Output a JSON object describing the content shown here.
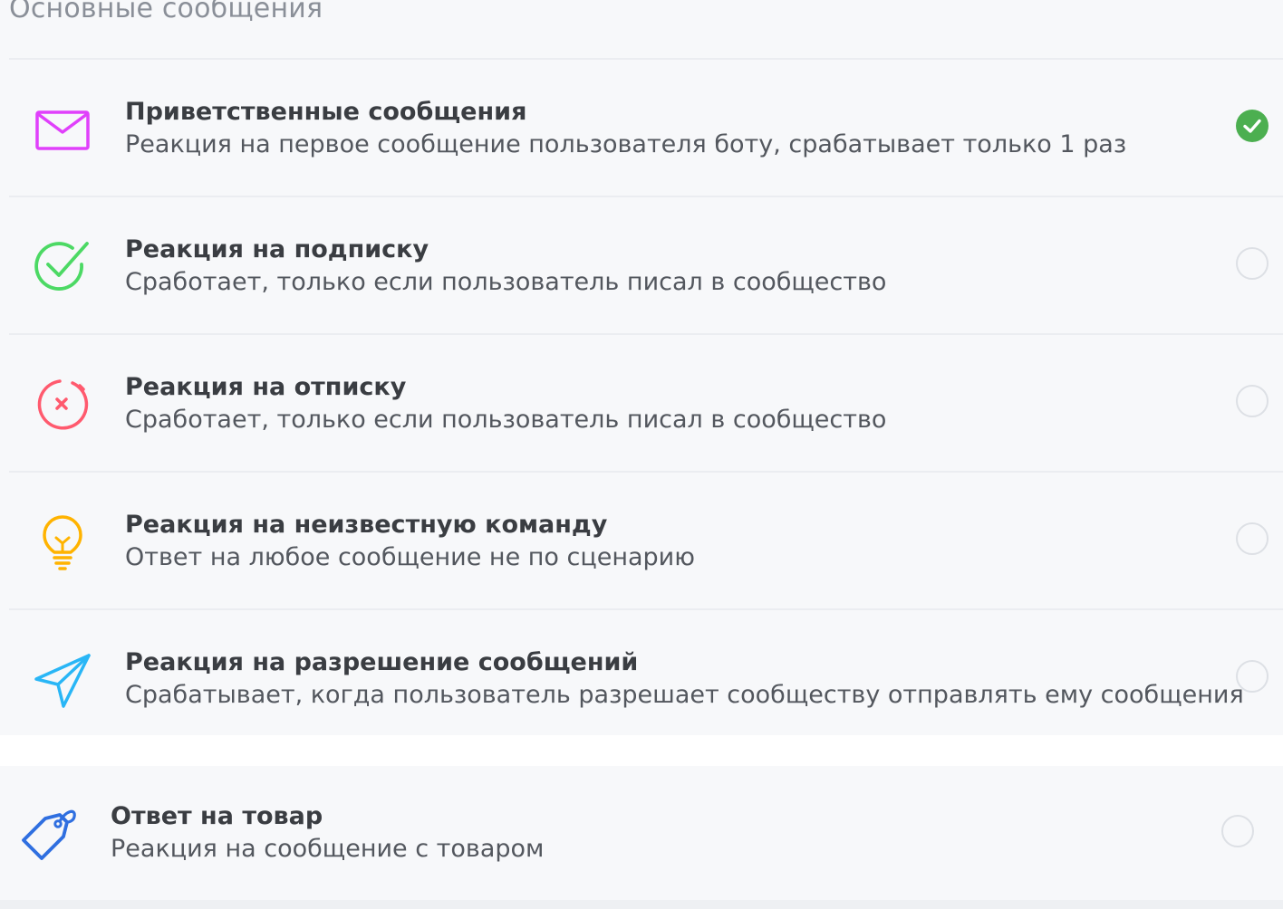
{
  "section": {
    "title": "Основные сообщения"
  },
  "colors": {
    "envelope": "#e040fb",
    "subscribe": "#4cd964",
    "unsubscribe": "#ff5a6e",
    "unknown": "#ffb300",
    "allow": "#29b6f6",
    "product": "#2f6fe0",
    "checked": "#4caf50"
  },
  "items": [
    {
      "icon": "envelope-icon",
      "title": "Приветственные сообщения",
      "desc": "Реакция на первое сообщение пользователя боту, срабатывает только 1 раз",
      "selected": true
    },
    {
      "icon": "check-circle-icon",
      "title": "Реакция на подписку",
      "desc": "Сработает, только если пользователь писал в сообщество",
      "selected": false
    },
    {
      "icon": "x-circle-icon",
      "title": "Реакция на отписку",
      "desc": "Сработает, только если пользователь писал в сообщество",
      "selected": false
    },
    {
      "icon": "lightbulb-icon",
      "title": "Реакция на неизвестную команду",
      "desc": "Ответ на любое сообщение не по сценарию",
      "selected": false
    },
    {
      "icon": "paper-plane-icon",
      "title": "Реакция на разрешение сообщений",
      "desc": "Срабатывает, когда пользователь разрешает сообществу отправлять ему сообщения",
      "selected": false
    }
  ],
  "product": {
    "icon": "price-tag-icon",
    "title": "Ответ на товар",
    "desc": "Реакция на сообщение с товаром",
    "selected": false
  }
}
